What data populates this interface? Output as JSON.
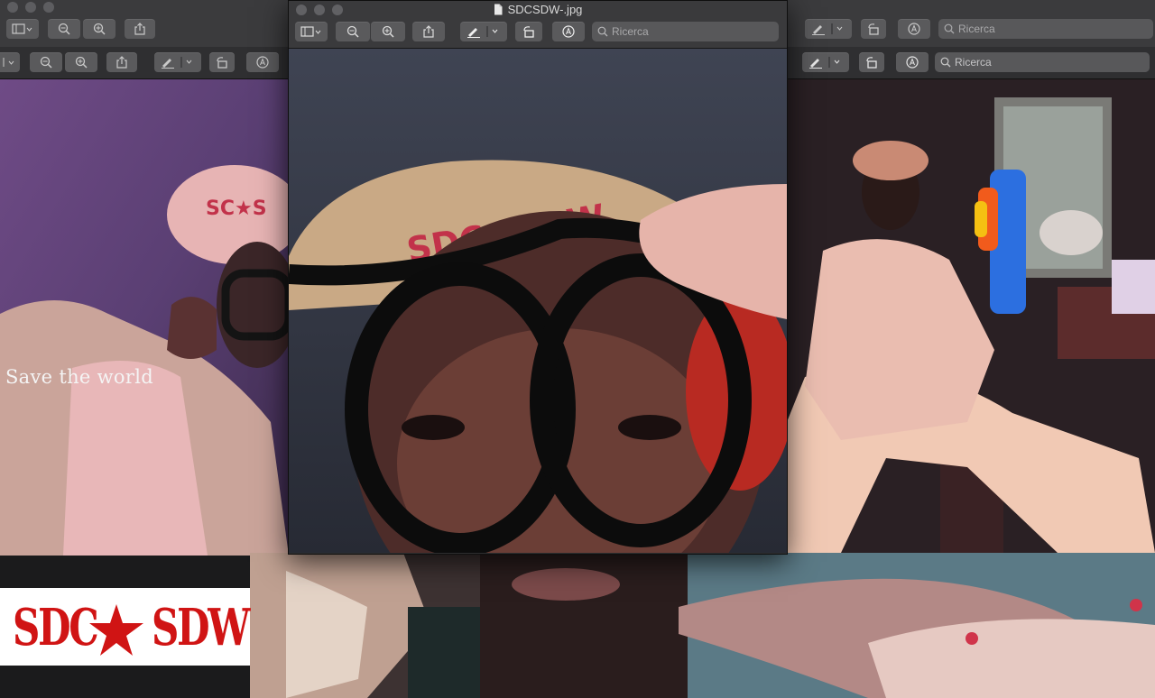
{
  "front_window": {
    "title": "SDCSDW-.jpg",
    "search_placeholder": "Ricerca"
  },
  "right_window": {
    "search_placeholder_top": "Ricerca",
    "search_placeholder": "Ricerca"
  },
  "left_photo": {
    "caption": "Save the world"
  },
  "logo": {
    "left_text": "SDC",
    "right_text": "SDW",
    "color": "#d01414"
  },
  "icons": [
    "sidebar-icon",
    "zoom-out-icon",
    "zoom-in-icon",
    "share-icon",
    "markup-pen-icon",
    "rotate-icon",
    "annotate-icon",
    "search-icon"
  ]
}
